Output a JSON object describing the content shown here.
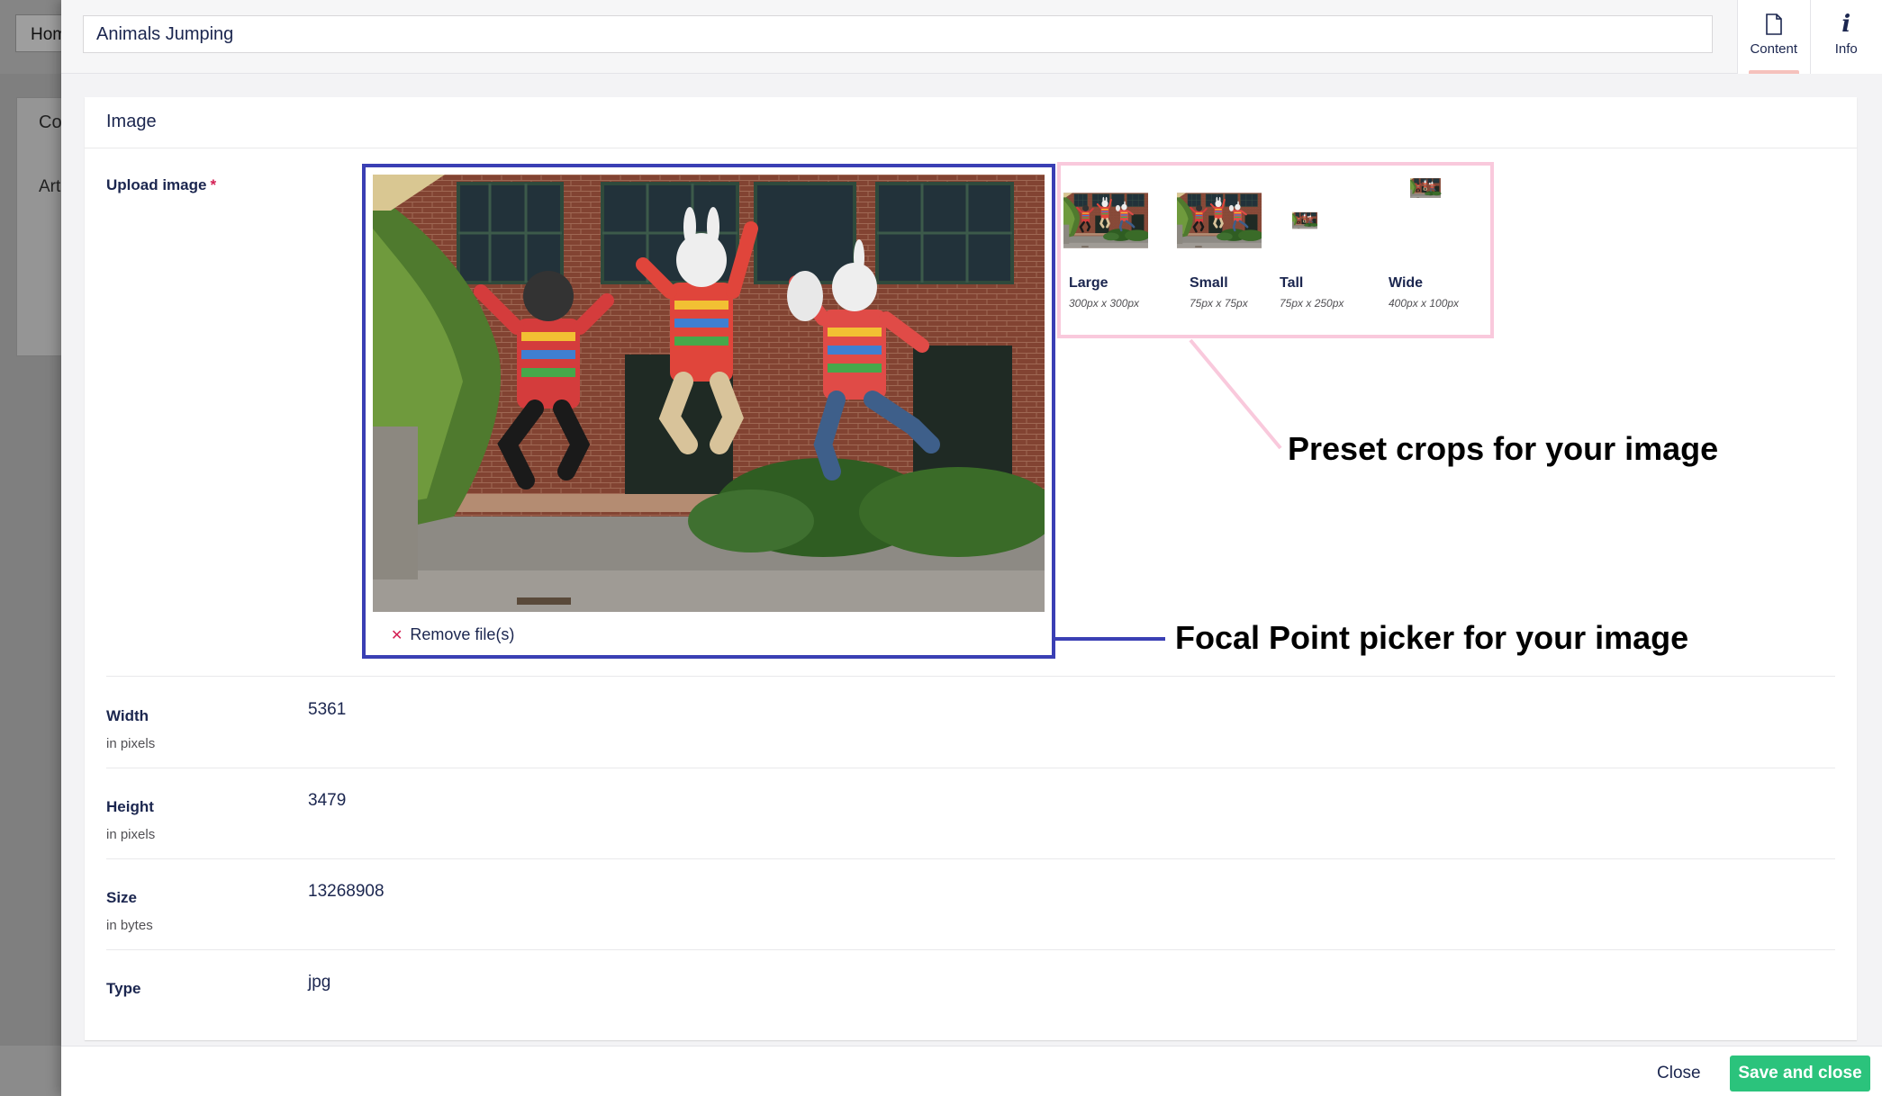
{
  "background": {
    "tab_label": "Home",
    "panel_title": "Co",
    "panel_item": "Art"
  },
  "header": {
    "name_value": "Animals Jumping",
    "tabs": [
      {
        "label": "Content",
        "icon": "document-icon",
        "active": true
      },
      {
        "label": "Info",
        "icon": "info-icon",
        "active": false
      }
    ]
  },
  "card": {
    "title": "Image",
    "upload": {
      "label": "Upload image",
      "required_mark": "*",
      "remove_label": "Remove file(s)"
    },
    "crops": [
      {
        "name": "Large",
        "dims": "300px x 300px"
      },
      {
        "name": "Small",
        "dims": "75px x 75px"
      },
      {
        "name": "Tall",
        "dims": "75px x 250px"
      },
      {
        "name": "Wide",
        "dims": "400px x 100px"
      }
    ],
    "annotations": {
      "crops": "Preset crops for your image",
      "focal": "Focal Point picker for your image"
    },
    "properties": [
      {
        "label": "Width",
        "sublabel": "in pixels",
        "value": "5361"
      },
      {
        "label": "Height",
        "sublabel": "in pixels",
        "value": "3479"
      },
      {
        "label": "Size",
        "sublabel": "in bytes",
        "value": "13268908"
      },
      {
        "label": "Type",
        "sublabel": "",
        "value": "jpg"
      }
    ]
  },
  "footer": {
    "close_label": "Close",
    "save_label": "Save and close"
  },
  "colors": {
    "focal_border": "#3a3fb4",
    "crops_border": "#f9c9dc",
    "save_button": "#2bc37c",
    "required": "#d42054"
  }
}
